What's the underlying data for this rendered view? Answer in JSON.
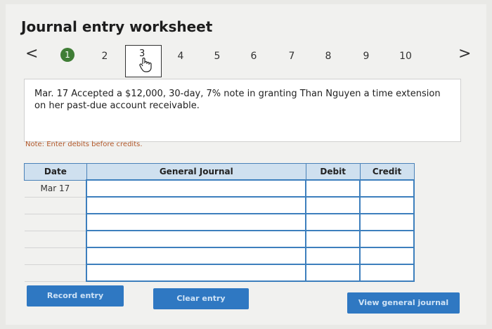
{
  "title": "Journal entry worksheet",
  "pager": {
    "prev": "<",
    "next": ">",
    "pages": [
      "1",
      "2",
      "3",
      "4",
      "5",
      "6",
      "7",
      "8",
      "9",
      "10"
    ],
    "current": "3",
    "completed": "1"
  },
  "description": "Mar. 17 Accepted a $12,000, 30-day, 7% note in granting Than Nguyen a time extension on her past-due account receivable.",
  "note": "Note: Enter debits before credits.",
  "table": {
    "headers": [
      "Date",
      "General Journal",
      "Debit",
      "Credit"
    ],
    "rows": [
      {
        "date": "Mar 17"
      },
      {
        "date": ""
      },
      {
        "date": ""
      },
      {
        "date": ""
      },
      {
        "date": ""
      },
      {
        "date": ""
      }
    ]
  },
  "buttons": {
    "record": "Record entry",
    "clear": "Clear entry",
    "view": "View general journal"
  },
  "colors": {
    "accent": "#2f78c2",
    "done": "#3f7d35",
    "note": "#b2582a"
  }
}
